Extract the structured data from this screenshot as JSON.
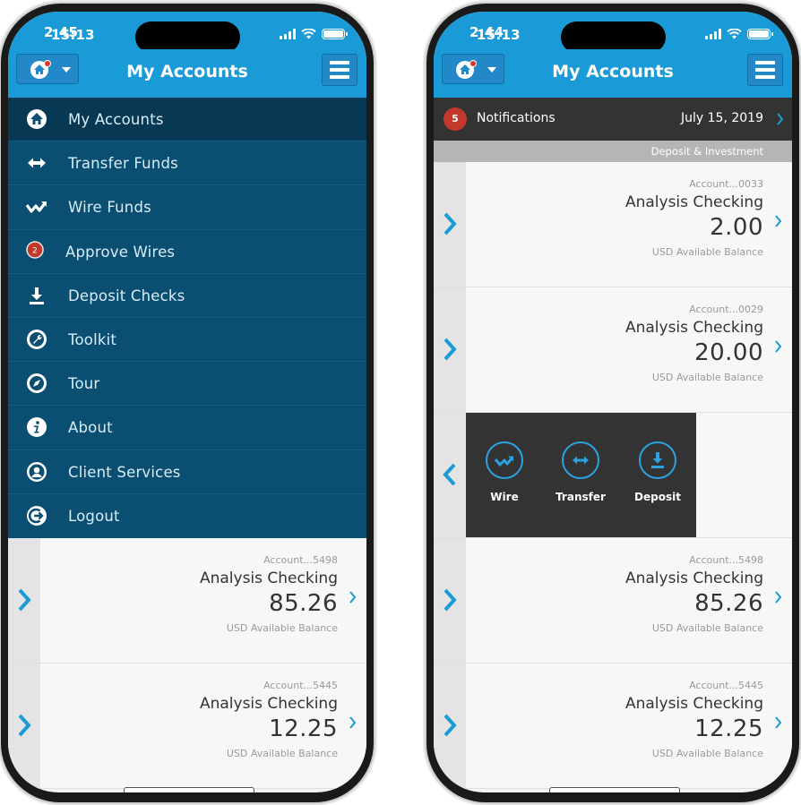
{
  "status_bar": {
    "time_left": "2:45",
    "time_right": "2:44",
    "time_overlay": "15:13"
  },
  "header": {
    "title": "My Accounts"
  },
  "menu": {
    "items": [
      {
        "label": "My Accounts",
        "icon": "home-icon"
      },
      {
        "label": "Transfer Funds",
        "icon": "transfer-arrows-icon"
      },
      {
        "label": "Wire Funds",
        "icon": "wire-icon"
      },
      {
        "label": "Approve Wires",
        "icon": "badge-count-icon",
        "badge": "2"
      },
      {
        "label": "Deposit Checks",
        "icon": "download-icon"
      },
      {
        "label": "Toolkit",
        "icon": "wrench-icon"
      },
      {
        "label": "Tour",
        "icon": "compass-icon"
      },
      {
        "label": "About",
        "icon": "info-icon"
      },
      {
        "label": "Client Services",
        "icon": "user-icon"
      },
      {
        "label": "Logout",
        "icon": "logout-icon"
      }
    ]
  },
  "notifications": {
    "count": "5",
    "label": "Notifications",
    "date": "July 15, 2019"
  },
  "section": {
    "label": "Deposit & Investment"
  },
  "accounts_left": [
    {
      "number": "Account...5498",
      "name": "Analysis Checking",
      "balance": "85.26",
      "label": "USD Available Balance"
    },
    {
      "number": "Account...5445",
      "name": "Analysis Checking",
      "balance": "12.25",
      "label": "USD Available Balance"
    }
  ],
  "accounts_right": [
    {
      "number": "Account...0033",
      "name": "Analysis Checking",
      "balance": "2.00",
      "label": "USD Available Balance"
    },
    {
      "number": "Account...0029",
      "name": "Analysis Checking",
      "balance": "20.00",
      "label": "USD Available Balance"
    },
    {
      "number": "Account...5498",
      "name": "Analysis Checking",
      "balance": "85.26",
      "label": "USD Available Balance"
    },
    {
      "number": "Account...5445",
      "name": "Analysis Checking",
      "balance": "12.25",
      "label": "USD Available Balance"
    }
  ],
  "actions": [
    {
      "label": "Wire",
      "icon": "wire-icon"
    },
    {
      "label": "Transfer",
      "icon": "transfer-arrows-icon"
    },
    {
      "label": "Deposit",
      "icon": "download-icon"
    }
  ],
  "colors": {
    "brand_blue": "#1a9ad6",
    "menu_bg": "#0a4f72",
    "menu_active": "#073954",
    "badge_red": "#c0392b",
    "dark_panel": "#333333"
  }
}
